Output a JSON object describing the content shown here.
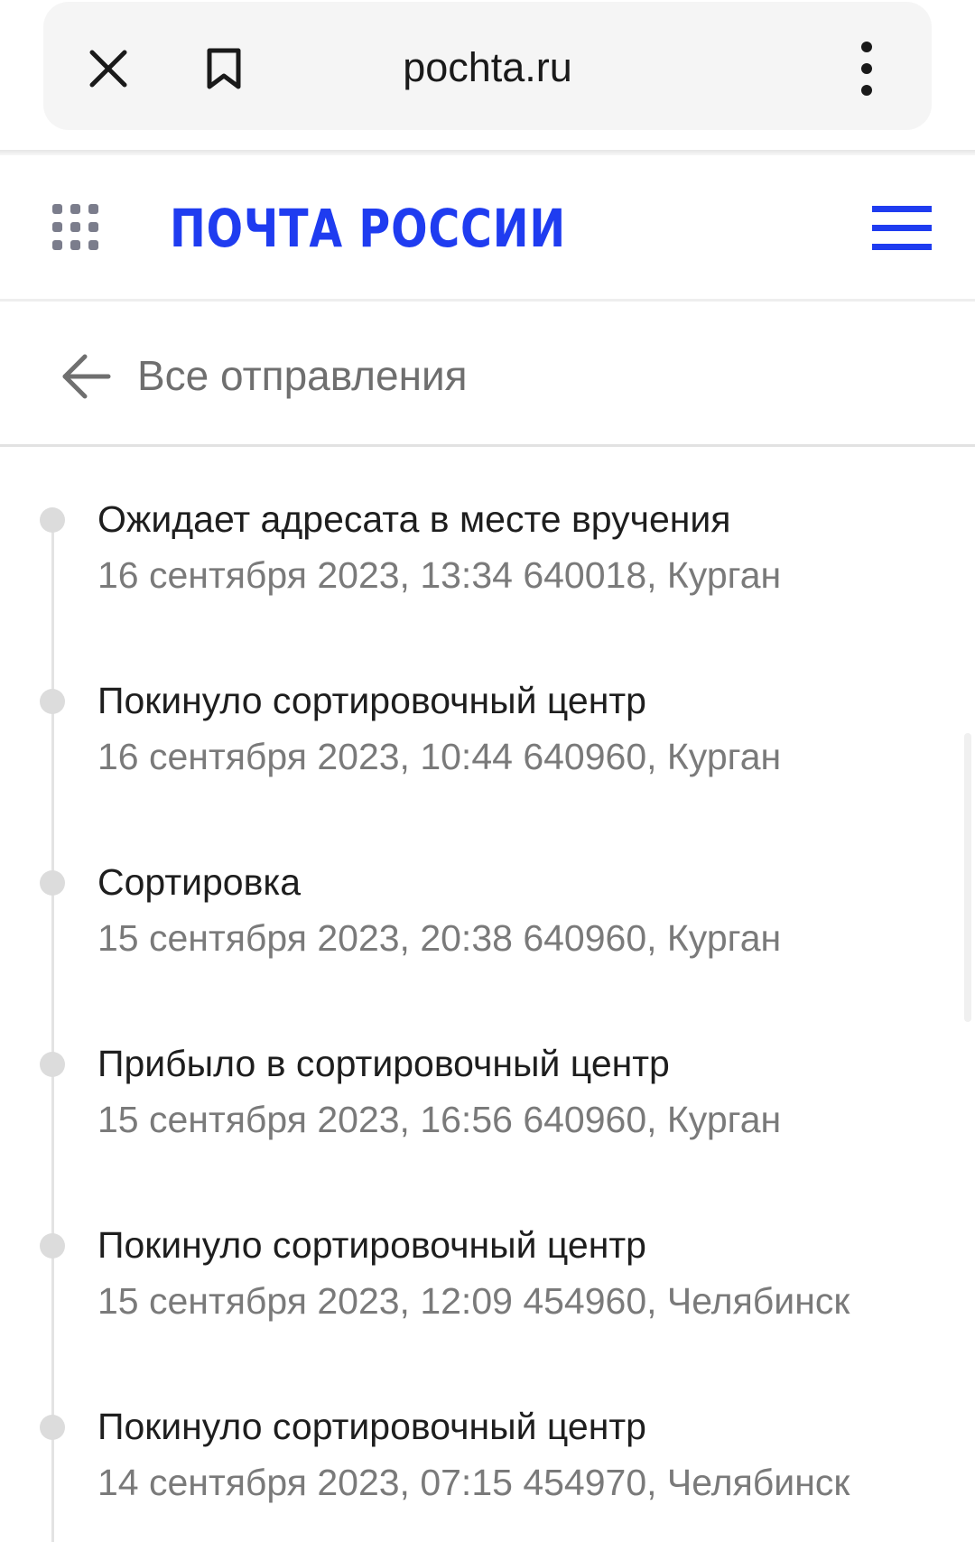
{
  "browser": {
    "url": "pochta.ru"
  },
  "header": {
    "logo": "ПОЧТА РОССИИ"
  },
  "nav": {
    "back_label": "Все отправления"
  },
  "colors": {
    "brand_blue": "#1f3cf0",
    "meta_gray": "#7a7a7a"
  },
  "events": [
    {
      "status": "Ожидает адресата в месте вручения",
      "details": "16 сентября 2023, 13:34 640018, Курган"
    },
    {
      "status": "Покинуло сортировочный центр",
      "details": "16 сентября 2023, 10:44 640960, Курган"
    },
    {
      "status": "Сортировка",
      "details": "15 сентября 2023, 20:38 640960, Курган"
    },
    {
      "status": "Прибыло в сортировочный центр",
      "details": "15 сентября 2023, 16:56 640960, Курган"
    },
    {
      "status": "Покинуло сортировочный центр",
      "details": "15 сентября 2023, 12:09 454960, Челябинск"
    },
    {
      "status": "Покинуло сортировочный центр",
      "details": "14 сентября 2023, 07:15 454970, Челябинск"
    }
  ]
}
